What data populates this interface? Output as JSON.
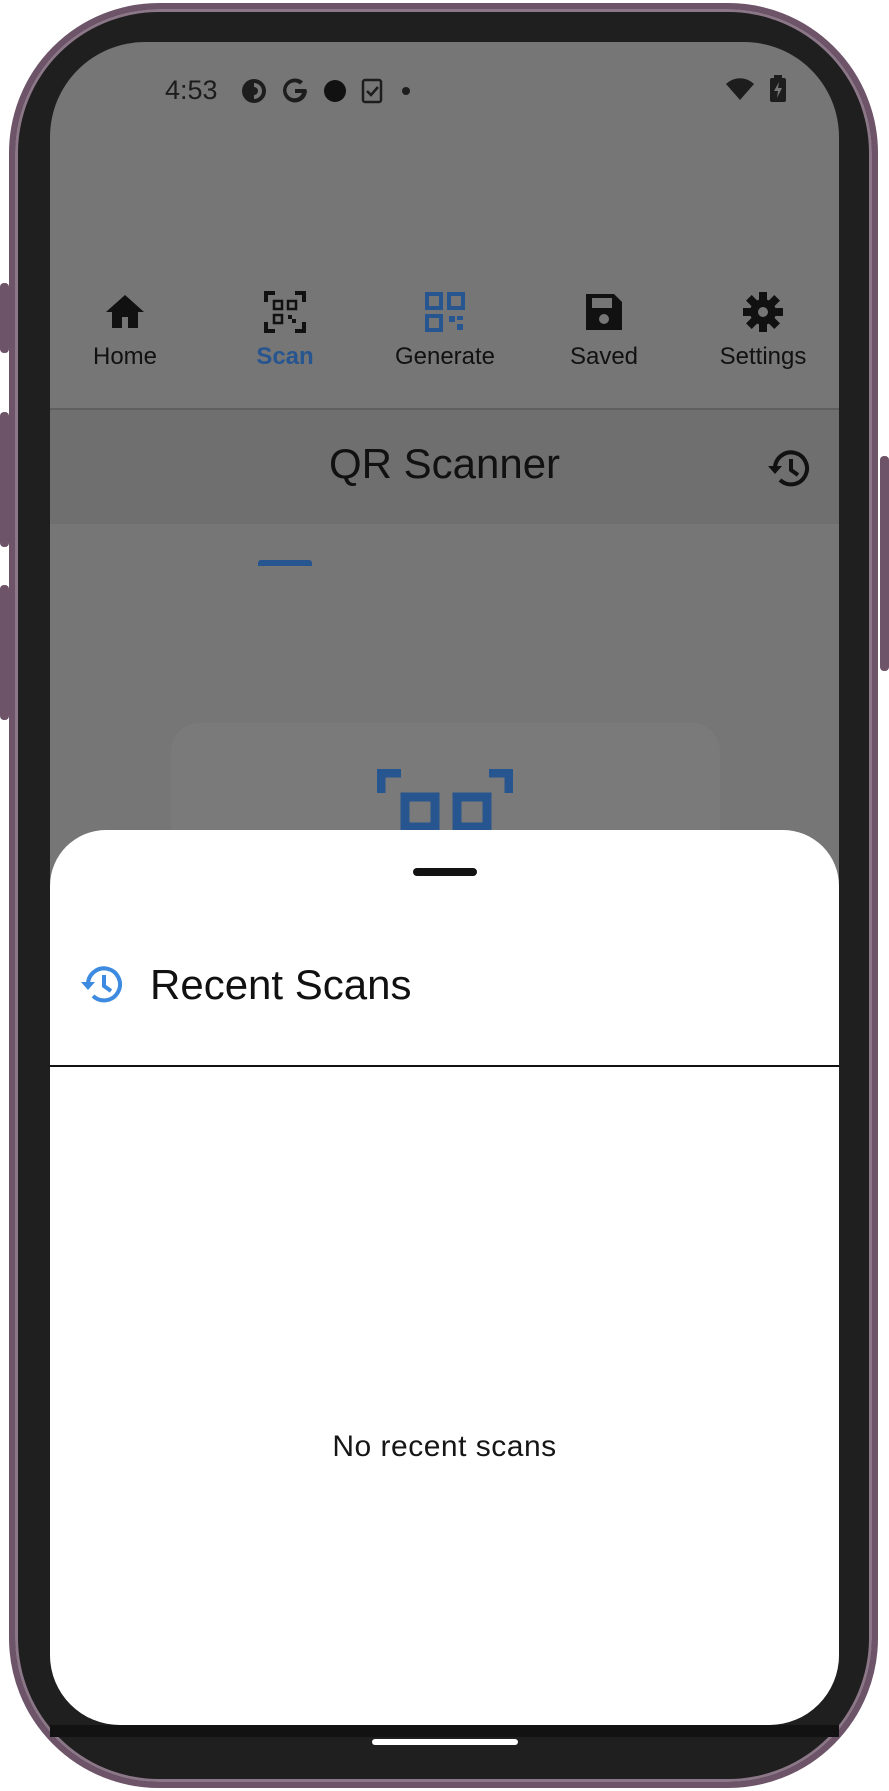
{
  "status_bar": {
    "time": "4:53",
    "left_icons": [
      "podcast-icon",
      "google-icon",
      "dot-icon",
      "clipboard-check-icon",
      "small-dot-icon"
    ],
    "right_icons": [
      "wifi-icon",
      "battery-charging-icon"
    ]
  },
  "tabs": [
    {
      "label": "Home",
      "icon": "home-icon",
      "active": false
    },
    {
      "label": "Scan",
      "icon": "qr-scan-icon",
      "active": true
    },
    {
      "label": "Generate",
      "icon": "qr-code-icon",
      "active": false
    },
    {
      "label": "Saved",
      "icon": "save-icon",
      "active": false
    },
    {
      "label": "Settings",
      "icon": "gear-icon",
      "active": false
    }
  ],
  "header": {
    "title": "QR Scanner",
    "history_icon": "history-icon"
  },
  "sheet": {
    "title": "Recent Scans",
    "title_icon": "history-icon",
    "empty_message": "No recent scans"
  },
  "colors": {
    "accent": "#27558f",
    "sheet_icon": "#3d8be0",
    "scrim": "#767676",
    "frame": "#6d5468"
  }
}
